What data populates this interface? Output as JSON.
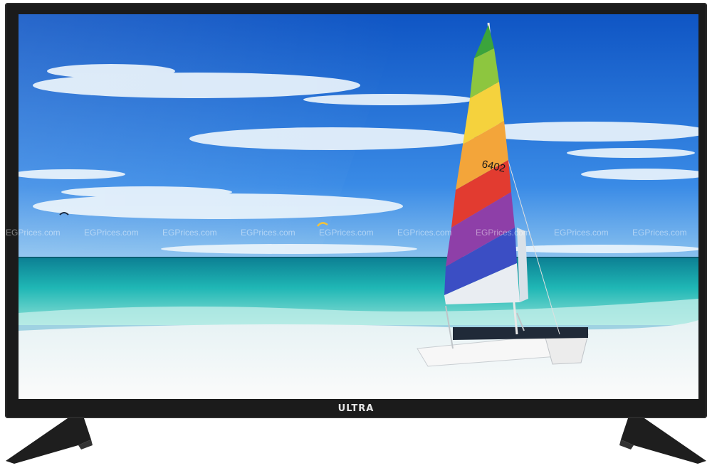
{
  "product": {
    "brand_label": "ULTRA"
  },
  "watermark": {
    "items": [
      "EGPrices.com",
      "EGPrices.com",
      "EGPrices.com",
      "EGPrices.com",
      "EGPrices.com",
      "EGPrices.com",
      "EGPrices.com",
      "EGPrices.com",
      "EGPrices.com"
    ]
  },
  "sail": {
    "number": "6402"
  },
  "colors": {
    "bezel": "#1b1b1b",
    "sky": "#1e63c9",
    "sea": "#1fb3b8",
    "sand": "#f4f6f7"
  }
}
